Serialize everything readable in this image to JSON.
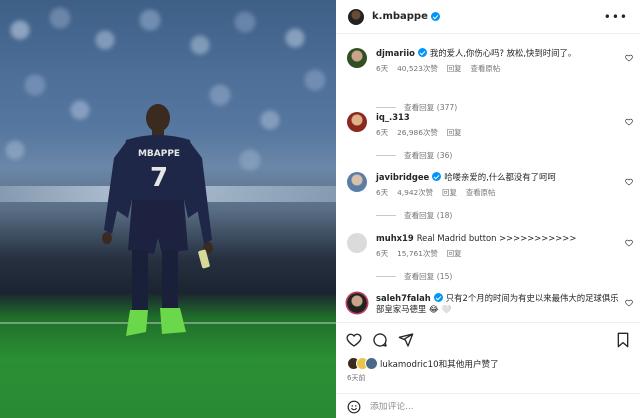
{
  "post": {
    "username": "k.mbappe",
    "verified": true,
    "jersey_name": "MBAPPE",
    "jersey_number": "7"
  },
  "comments": [
    {
      "user": "djmariio",
      "verified": true,
      "text": "我的爱人,你伤心吗? 放松,快到时间了。",
      "age": "6天",
      "likes": "40,523次赞",
      "reply": "回复",
      "translate": "查看原帖",
      "view_replies": "查看回复 (377)",
      "avatar_color": "#3b6b2f"
    },
    {
      "user": "iq_.313",
      "verified": false,
      "text": "",
      "age": "6天",
      "likes": "26,986次赞",
      "reply": "回复",
      "translate": "",
      "view_replies": "查看回复 (36)",
      "avatar_color": "#8a2a1e"
    },
    {
      "user": "javibridgee",
      "verified": true,
      "text": "哈喽亲爱的,什么都没有了呵呵",
      "age": "6天",
      "likes": "4,942次赞",
      "reply": "回复",
      "translate": "查看原帖",
      "view_replies": "查看回复 (18)",
      "avatar_color": "#5b7ea6"
    },
    {
      "user": "muhx19",
      "verified": false,
      "text": "Real Madrid button >>>>>>>>>>>",
      "age": "6天",
      "likes": "15,761次赞",
      "reply": "回复",
      "translate": "",
      "view_replies": "查看回复 (15)",
      "avatar_color": "#c9c9c9"
    },
    {
      "user": "saleh7falah",
      "verified": true,
      "text": "只有2个月的时间为有史以来最伟大的足球俱乐部皇家马德里 😂 🤍",
      "age": "",
      "likes": "",
      "reply": "",
      "translate": "",
      "view_replies": "",
      "avatar_color": "#c9375a"
    }
  ],
  "footer": {
    "liked_by": "lukamodric10和其他用户赞了",
    "date": "6天前",
    "comment_placeholder": "添加评论..."
  },
  "icons": [
    "more-icon",
    "heart-icon",
    "comment-icon",
    "share-icon",
    "bookmark-icon",
    "emoji-icon"
  ]
}
